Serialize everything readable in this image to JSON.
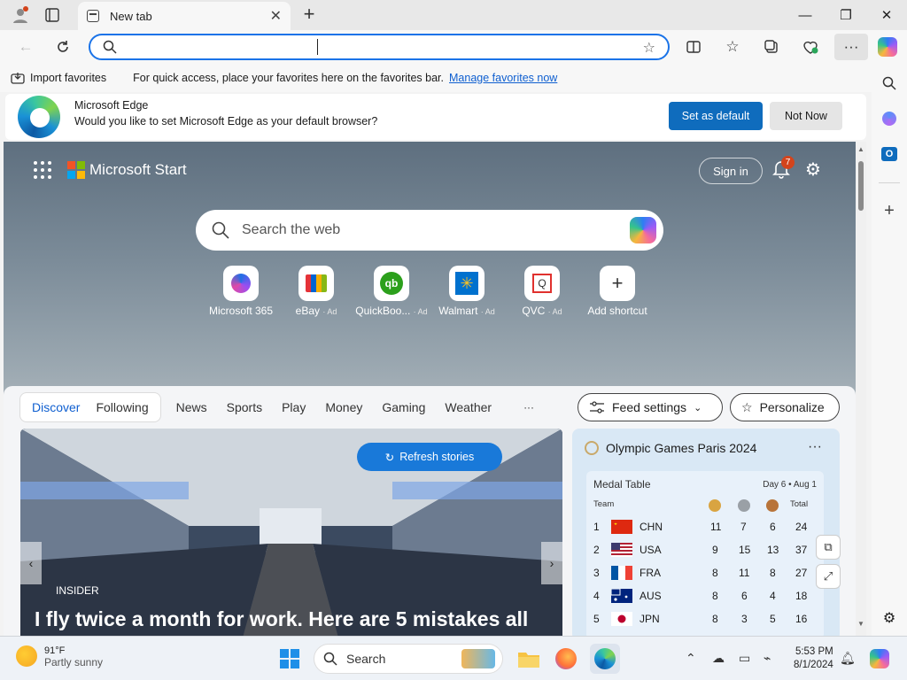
{
  "browser": {
    "tab_title": "New tab",
    "window_controls": {
      "minimize": "—",
      "restore": "❐",
      "close": "✕"
    }
  },
  "favorites_bar": {
    "import_label": "Import favorites",
    "message": "For quick access, place your favorites here on the favorites bar.",
    "manage_link": "Manage favorites now"
  },
  "default_banner": {
    "title": "Microsoft Edge",
    "message": "Would you like to set Microsoft Edge as your default browser?",
    "primary": "Set as default",
    "secondary": "Not Now"
  },
  "start": {
    "brand": "Microsoft Start",
    "sign_in": "Sign in",
    "notification_count": "7",
    "search_placeholder": "Search the web",
    "shortcuts": [
      {
        "label": "Microsoft 365",
        "ad": ""
      },
      {
        "label": "eBay",
        "ad": "· Ad"
      },
      {
        "label": "QuickBoo...",
        "ad": "· Ad"
      },
      {
        "label": "Walmart",
        "ad": "· Ad"
      },
      {
        "label": "QVC",
        "ad": "· Ad"
      },
      {
        "label": "Add shortcut",
        "ad": ""
      }
    ]
  },
  "feed": {
    "tabs": [
      "Discover",
      "Following",
      "News",
      "Sports",
      "Play",
      "Money",
      "Gaming",
      "Weather"
    ],
    "more": "···",
    "feed_settings": "Feed settings",
    "personalize": "Personalize",
    "hero": {
      "refresh": "Refresh stories",
      "source": "INSIDER",
      "headline": "I fly twice a month for work. Here are 5 mistakes all"
    }
  },
  "olympics": {
    "title": "Olympic Games Paris 2024",
    "medal_table_title": "Medal Table",
    "day": "Day 6 • Aug 1",
    "col_team": "Team",
    "col_total": "Total",
    "rows": [
      {
        "rank": "1",
        "team": "CHN",
        "gold": "11",
        "silver": "7",
        "bronze": "6",
        "total": "24"
      },
      {
        "rank": "2",
        "team": "USA",
        "gold": "9",
        "silver": "15",
        "bronze": "13",
        "total": "37"
      },
      {
        "rank": "3",
        "team": "FRA",
        "gold": "8",
        "silver": "11",
        "bronze": "8",
        "total": "27"
      },
      {
        "rank": "4",
        "team": "AUS",
        "gold": "8",
        "silver": "6",
        "bronze": "4",
        "total": "18"
      },
      {
        "rank": "5",
        "team": "JPN",
        "gold": "8",
        "silver": "3",
        "bronze": "5",
        "total": "16"
      }
    ]
  },
  "taskbar": {
    "temperature": "91°F",
    "condition": "Partly sunny",
    "search": "Search",
    "time": "5:53 PM",
    "date": "8/1/2024"
  },
  "colors": {
    "accent": "#0f6cbd",
    "link": "#0f5fd0",
    "refresh": "#1979d9",
    "badge": "#d3441c"
  }
}
